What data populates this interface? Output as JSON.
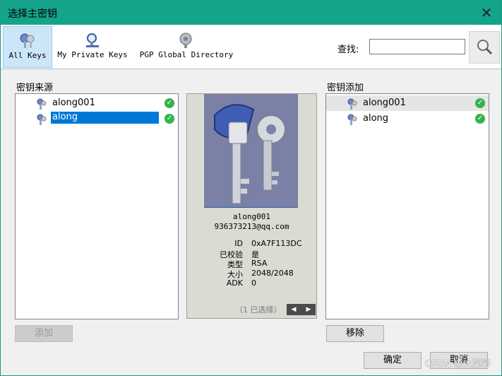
{
  "window": {
    "title": "选择主密钥",
    "close_glyph": "✕"
  },
  "toolbar": {
    "tabs": [
      {
        "label": "All Keys",
        "icon": "keys-icon",
        "active": true
      },
      {
        "label": "My Private Keys",
        "icon": "private-key-search-icon",
        "active": false
      },
      {
        "label": "PGP Global Directory",
        "icon": "global-directory-icon",
        "active": false
      }
    ],
    "find_label": "查找:",
    "find_value": "",
    "search_icon": "magnifier-icon"
  },
  "source": {
    "label": "密钥来源",
    "items": [
      {
        "name": "along001",
        "selected": false
      },
      {
        "name": "along",
        "selected": true
      }
    ],
    "add_button": "添加"
  },
  "detail": {
    "name": "along001",
    "email": "936373213@qq.com",
    "fields": [
      {
        "key": "ID",
        "value": "0xA7F113DC"
      },
      {
        "key": "已校验",
        "value": "是"
      },
      {
        "key": "类型",
        "value": "RSA"
      },
      {
        "key": "大小",
        "value": "2048/2048"
      },
      {
        "key": "ADK",
        "value": "0"
      }
    ],
    "selection_count": "（1 已选择）",
    "prev_glyph": "◀",
    "next_glyph": "▶"
  },
  "added": {
    "label": "密钥添加",
    "items": [
      {
        "name": "along001"
      },
      {
        "name": "along"
      }
    ],
    "remove_button": "移除"
  },
  "footer": {
    "ok_button": "确定",
    "cancel_button": "取消"
  },
  "watermark": "CSDN @大菜彩",
  "colors": {
    "titlebar": "#13a48a",
    "selection": "#0078d7",
    "check": "#34b34a"
  }
}
